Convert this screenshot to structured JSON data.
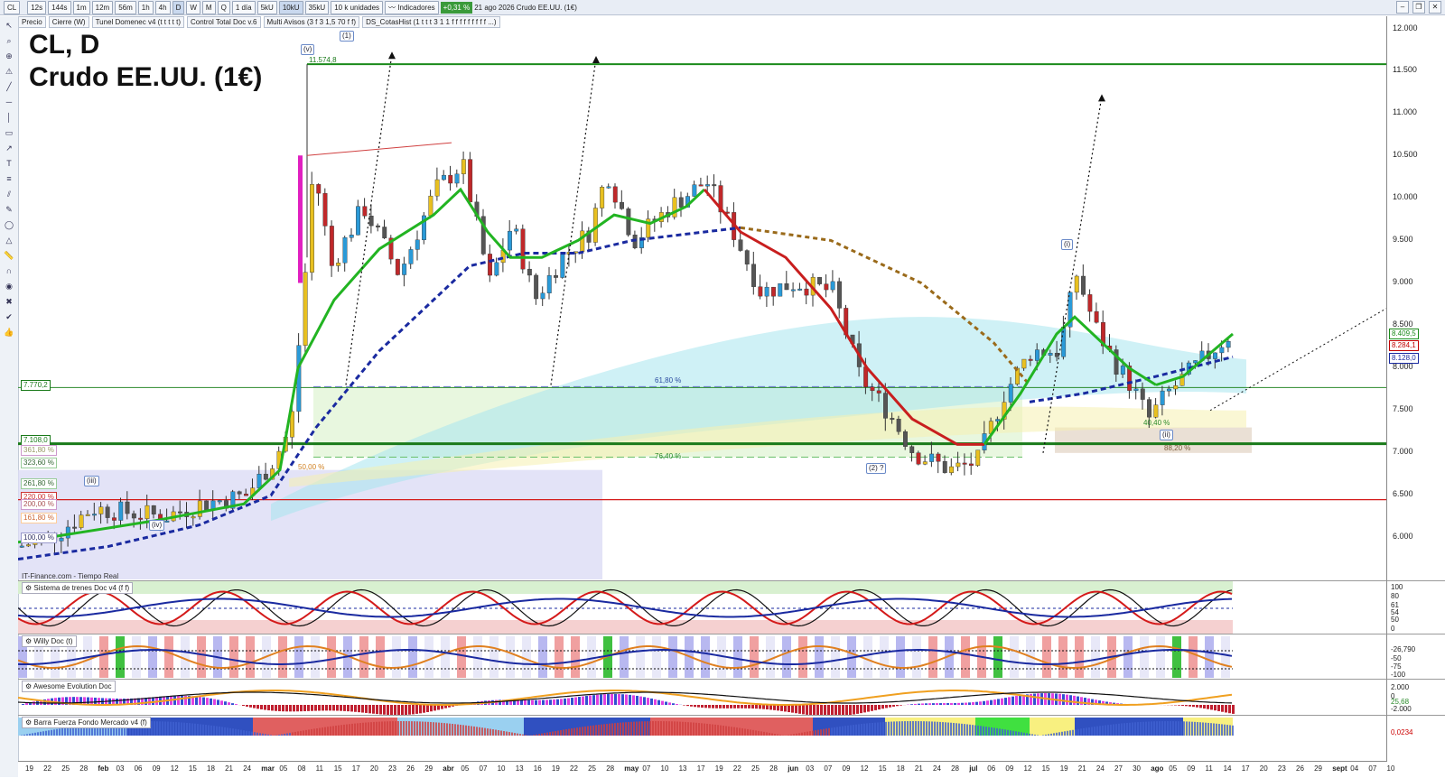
{
  "toolbar": {
    "symbol": "CL",
    "timeframes": [
      "12s",
      "144s",
      "1m",
      "12m",
      "56m",
      "1h",
      "4h",
      "D",
      "W",
      "M",
      "Q"
    ],
    "period": "1 día",
    "volume_btns": [
      "5kU",
      "10kU",
      "35kU"
    ],
    "units": "10 k unidades",
    "indicators_label": "Indicadores",
    "change_badge": "+0,31 %",
    "date": "21 ago 2026",
    "instrument": "Crudo EE.UU. (1€)"
  },
  "indicator_chips": [
    "Precio",
    "Cierre (W)",
    "Tunel Domenec v4 (t t t t t)",
    "Control Total Doc v.6",
    "Multi Avisos (3 f 3 1,5 70 f f)",
    "DS_CotasHist (1 t t t 3 1 1 f f f f f f f f f ...)"
  ],
  "title": {
    "line1": "CL, D",
    "line2": "Crudo EE.UU. (1€)"
  },
  "price_axis": {
    "labels": [
      "12.000",
      "11.500",
      "11.000",
      "10.500",
      "10.000",
      "9.500",
      "9.000",
      "8.500",
      "8.000",
      "7.500",
      "7.000",
      "6.500",
      "6.000"
    ],
    "boxes": [
      {
        "text": "8.409,5",
        "color": "#1a8a1a"
      },
      {
        "text": "8.284,1",
        "color": "#c00000"
      },
      {
        "text": "8.128,0",
        "color": "#1a2aa0"
      }
    ]
  },
  "levels": {
    "top": "11.574,8",
    "l7770": "7.770,2",
    "l7108": "7.108,0",
    "fib_61": "61,80 %",
    "fib_76": "76,40 %",
    "fib_88": "88,20 %",
    "fib_40": "40,40 %",
    "fib_50": "50,00 %",
    "left_pcts": [
      "361,80 %",
      "323,60 %",
      "261,80 %",
      "220,00 %",
      "200,00 %",
      "161,80 %",
      "100,00 %"
    ]
  },
  "waves": [
    "(v)",
    "(1)",
    "(iii)",
    "(iv)",
    "(2) ?",
    "(i)",
    "(ii)"
  ],
  "source": "IT-Finance.com - Tiempo Real",
  "panels": [
    {
      "name": "Sistema de trenes Doc v4 (f f)",
      "axis": [
        "100",
        "80",
        "61",
        "54",
        "50",
        "0"
      ]
    },
    {
      "name": "Willy Doc (t)",
      "axis": [
        "-26,790",
        "-50",
        "-75",
        "-100"
      ]
    },
    {
      "name": "Awesome Evolution Doc",
      "axis": [
        "2.000",
        "0",
        "-2.000",
        "25,68"
      ]
    },
    {
      "name": "Barra Fuerza Fondo Mercado v4 (f)",
      "axis": [
        "0,0234"
      ]
    }
  ],
  "xaxis": {
    "labels": [
      "19",
      "22",
      "25",
      "28",
      "feb",
      "03",
      "06",
      "09",
      "12",
      "15",
      "18",
      "21",
      "24",
      "mar",
      "05",
      "08",
      "11",
      "15",
      "17",
      "20",
      "23",
      "26",
      "29",
      "abr",
      "05",
      "07",
      "10",
      "13",
      "16",
      "19",
      "22",
      "25",
      "28",
      "may",
      "07",
      "10",
      "13",
      "17",
      "19",
      "22",
      "25",
      "28",
      "jun",
      "03",
      "07",
      "09",
      "12",
      "15",
      "18",
      "21",
      "24",
      "28",
      "jul",
      "06",
      "09",
      "12",
      "15",
      "19",
      "21",
      "24",
      "27",
      "30",
      "ago",
      "05",
      "09",
      "11",
      "14",
      "17",
      "20",
      "23",
      "26",
      "29",
      "sept",
      "04",
      "07",
      "10"
    ],
    "bold": [
      "feb",
      "mar",
      "abr",
      "may",
      "jun",
      "jul",
      "ago",
      "sept"
    ]
  },
  "colors": {
    "bull": "#2d9b2d",
    "bear": "#c81e1e",
    "ma_blue": "#1a2aa0",
    "ma_brown": "#9a6a1a",
    "green_line": "#1a8a1a",
    "red_line": "#d41a1a"
  }
}
